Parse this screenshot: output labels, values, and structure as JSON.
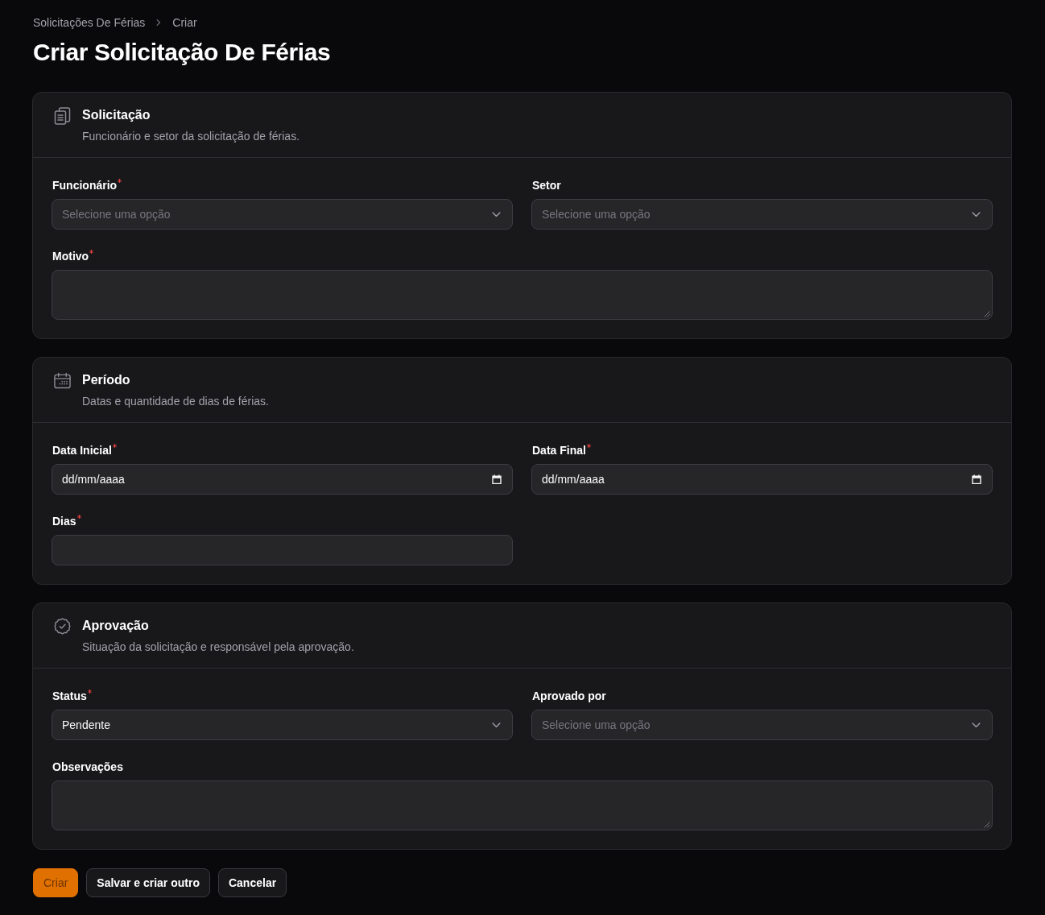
{
  "breadcrumbs": [
    {
      "label": "Solicitações De Férias"
    },
    {
      "label": "Criar"
    }
  ],
  "title": "Criar Solicitação De Férias",
  "sections": [
    {
      "title": "Solicitação",
      "description": "Funcionário e setor da solicitação de férias.",
      "fields": [
        {
          "kind": "select",
          "label": "Funcionário",
          "required": true,
          "placeholder": "Selecione uma opção"
        },
        {
          "kind": "select",
          "label": "Setor",
          "required": false,
          "placeholder": "Selecione uma opção"
        },
        {
          "kind": "textarea",
          "label": "Motivo",
          "required": true
        }
      ]
    },
    {
      "title": "Período",
      "description": "Datas e quantidade de dias de férias.",
      "fields": [
        {
          "kind": "date",
          "label": "Data Inicial",
          "required": true,
          "value": "dd/mm/aaaa"
        },
        {
          "kind": "date",
          "label": "Data Final",
          "required": true,
          "value": "dd/mm/aaaa"
        },
        {
          "kind": "text",
          "label": "Dias",
          "required": true
        }
      ]
    },
    {
      "title": "Aprovação",
      "description": "Situação da solicitação e responsável pela aprovação.",
      "fields": [
        {
          "kind": "select",
          "label": "Status",
          "required": true,
          "value": "Pendente"
        },
        {
          "kind": "select",
          "label": "Aprovado por",
          "required": false,
          "placeholder": "Selecione uma opção"
        },
        {
          "kind": "textarea",
          "label": "Observações",
          "required": false
        }
      ]
    }
  ],
  "actions": [
    {
      "label": "Criar",
      "kind": "primary"
    },
    {
      "label": "Salvar e criar outro",
      "kind": "secondary"
    },
    {
      "label": "Cancelar",
      "kind": "secondary"
    }
  ]
}
